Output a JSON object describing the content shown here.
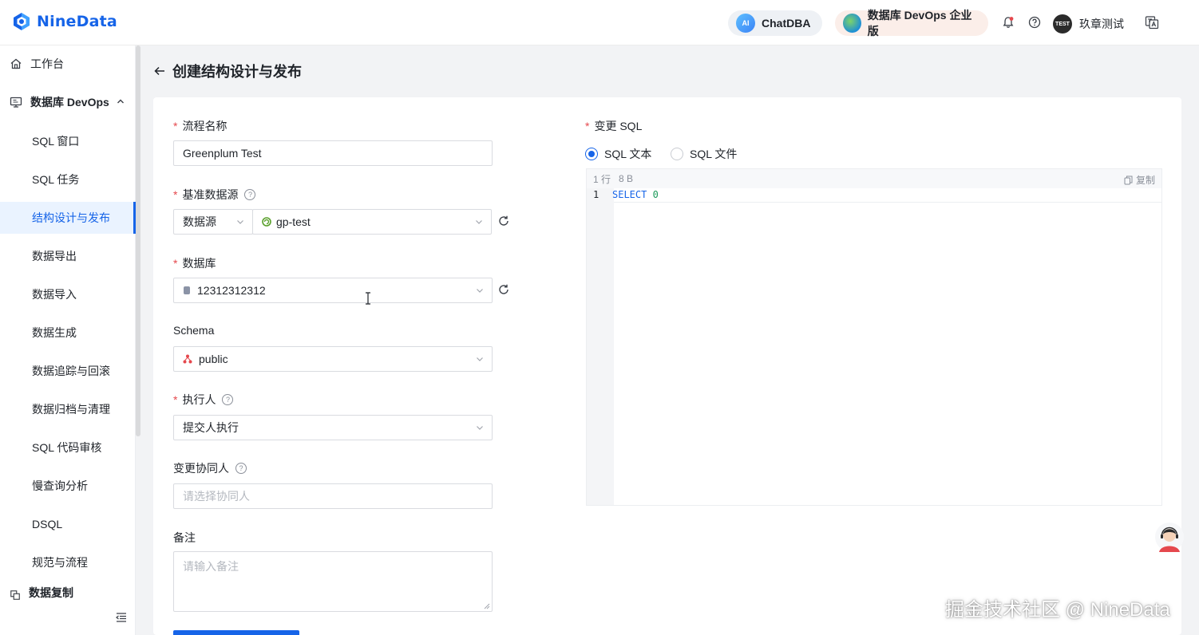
{
  "header": {
    "logo_text": "NineData",
    "chatdba_label": "ChatDBA",
    "chatdba_icon_text": "AI",
    "devops_label": "数据库 DevOps 企业版",
    "avatar_text": "TEST",
    "user_name": "玖章测试"
  },
  "sidebar": {
    "workbench": "工作台",
    "devops_group": "数据库 DevOps",
    "items": [
      "SQL 窗口",
      "SQL 任务",
      "结构设计与发布",
      "数据导出",
      "数据导入",
      "数据生成",
      "数据追踪与回滚",
      "数据归档与清理",
      "SQL 代码审核",
      "慢查询分析",
      "DSQL",
      "规范与流程"
    ],
    "active_index": 2,
    "next_group": "数据复制"
  },
  "page": {
    "title": "创建结构设计与发布"
  },
  "form": {
    "flow_name_label": "流程名称",
    "flow_name_value": "Greenplum Test",
    "datasource_label": "基准数据源",
    "datasource_type": "数据源",
    "datasource_value": "gp-test",
    "database_label": "数据库",
    "database_value": "12312312312",
    "schema_label": "Schema",
    "schema_value": "public",
    "executor_label": "执行人",
    "executor_value": "提交人执行",
    "collaborator_label": "变更协同人",
    "collaborator_placeholder": "请选择协同人",
    "remark_label": "备注",
    "remark_placeholder": "请输入备注"
  },
  "sql": {
    "label": "变更 SQL",
    "option_text": "SQL 文本",
    "option_file": "SQL 文件",
    "selected": "SQL 文本",
    "line_count": "1 行",
    "byte_count": "8 B",
    "copy_label": "复制",
    "line_number": "1",
    "code_keyword": "SELECT",
    "code_value": "0"
  },
  "watermark": "掘金技术社区 @ NineData",
  "colors": {
    "brand": "#1664e8",
    "required": "#e5484d",
    "active_bg": "#eaf3ff"
  }
}
